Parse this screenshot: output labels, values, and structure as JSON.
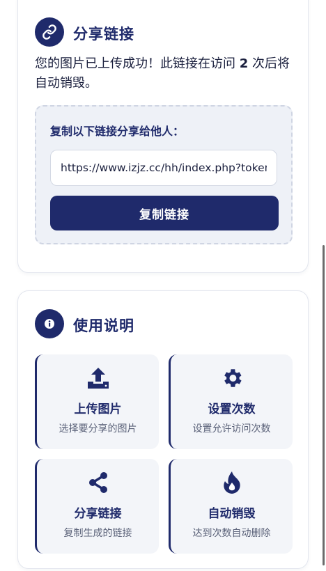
{
  "share": {
    "title": "分享链接",
    "desc_prefix": "您的图片已上传成功！此链接在访问 ",
    "visit_count": "2",
    "desc_suffix": " 次后将自动销毁。",
    "box_label": "复制以下链接分享给他人：",
    "url_value": "https://www.izjz.cc/hh/index.php?token=",
    "copy_button": "复制链接"
  },
  "usage": {
    "title": "使用说明",
    "features": [
      {
        "icon": "upload-icon",
        "title": "上传图片",
        "desc": "选择要分享的图片"
      },
      {
        "icon": "gear-icon",
        "title": "设置次数",
        "desc": "设置允许访问次数"
      },
      {
        "icon": "share-icon",
        "title": "分享链接",
        "desc": "复制生成的链接"
      },
      {
        "icon": "fire-icon",
        "title": "自动销毁",
        "desc": "达到次数自动删除"
      }
    ]
  },
  "colors": {
    "primary": "#1f2a6b",
    "box_bg": "#eef1f7",
    "feature_bg": "#f3f5f9"
  }
}
